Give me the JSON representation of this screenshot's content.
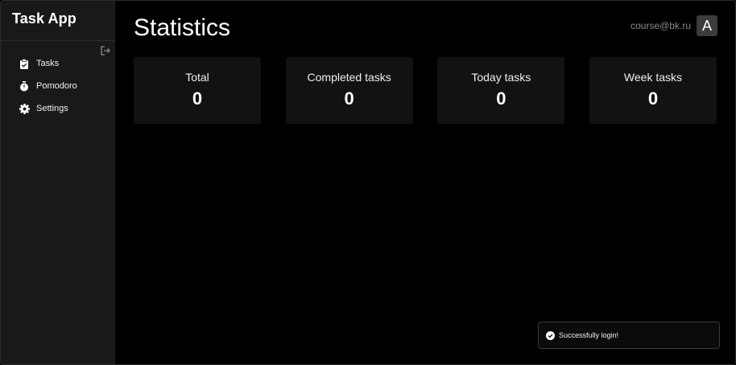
{
  "app": {
    "title": "Task App"
  },
  "sidebar": {
    "items": [
      {
        "label": "Tasks",
        "icon": "clipboard-check-icon"
      },
      {
        "label": "Pomodoro",
        "icon": "stopwatch-icon"
      },
      {
        "label": "Settings",
        "icon": "gear-icon"
      }
    ],
    "logout_icon": "logout-icon"
  },
  "header": {
    "title": "Statistics",
    "user_email": "course@bk.ru",
    "avatar_letter": "A"
  },
  "stats": [
    {
      "label": "Total",
      "value": "0"
    },
    {
      "label": "Completed tasks",
      "value": "0"
    },
    {
      "label": "Today tasks",
      "value": "0"
    },
    {
      "label": "Week tasks",
      "value": "0"
    }
  ],
  "toast": {
    "message": "Successfully login!",
    "icon": "check-circle-icon"
  },
  "colors": {
    "background": "#000000",
    "sidebar": "#181a1a",
    "card": "#111212",
    "muted_text": "#8a8a8a"
  }
}
